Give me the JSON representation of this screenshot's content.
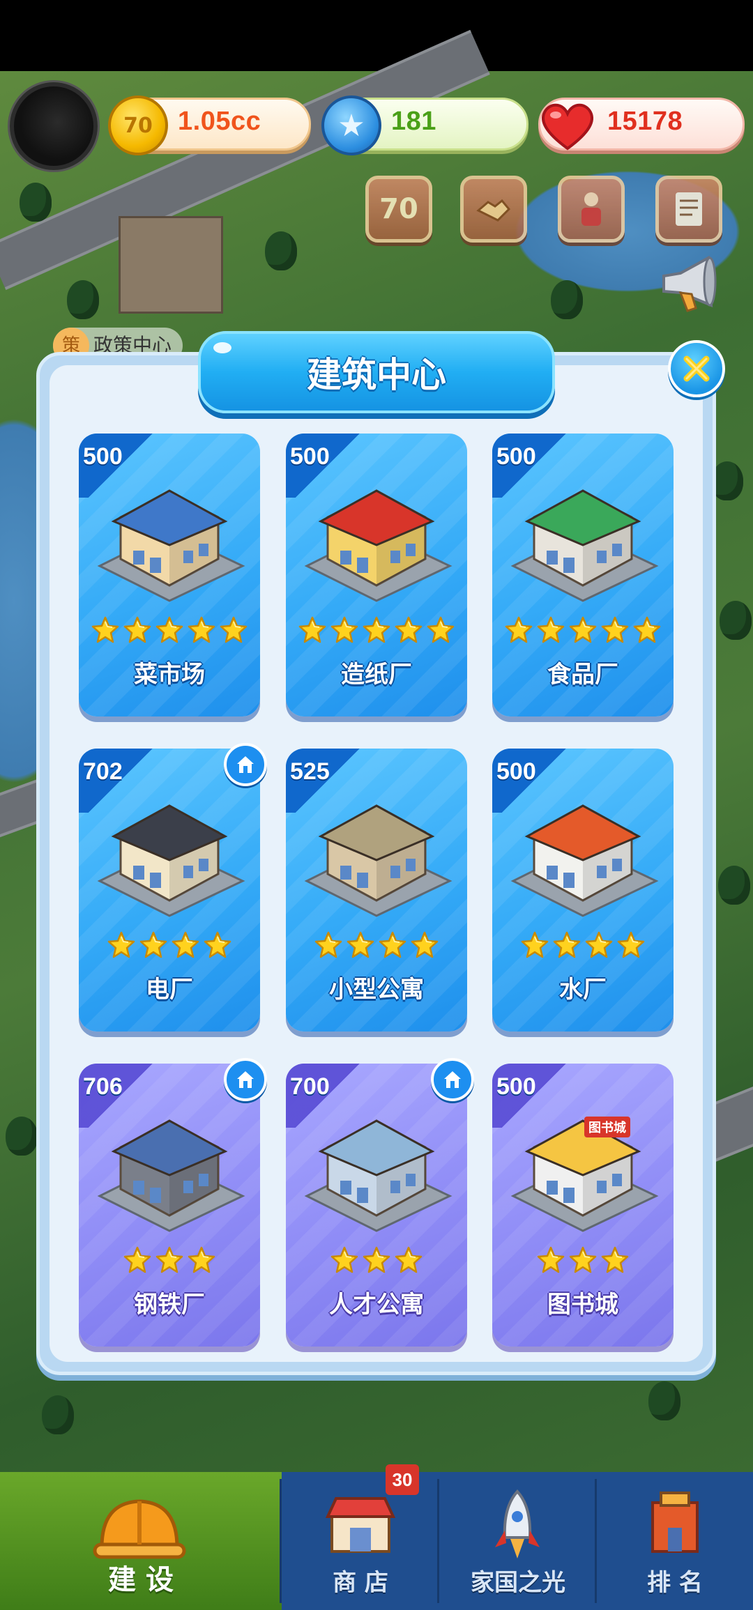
{
  "resources": {
    "coins": {
      "value": "1.05cc",
      "icon": "coin-icon",
      "coin_mark": "70"
    },
    "stars": {
      "value": "181",
      "icon": "star-coin-icon"
    },
    "hearts": {
      "value": "15178",
      "icon": "heart-icon"
    }
  },
  "hud_buttons": [
    {
      "icon": "anniversary-70-icon",
      "label": "70"
    },
    {
      "icon": "handshake-icon",
      "label": ""
    },
    {
      "icon": "hero-icon",
      "label": ""
    },
    {
      "icon": "task-list-icon",
      "label": ""
    }
  ],
  "map": {
    "policy_badge": "策",
    "policy_label": "政策中心"
  },
  "dialog": {
    "title": "建筑中心",
    "buildings": [
      {
        "name": "菜市场",
        "level": "500",
        "stars": 5,
        "theme": "blue",
        "has_home_badge": false,
        "icon": "vegetable-market-icon"
      },
      {
        "name": "造纸厂",
        "level": "500",
        "stars": 5,
        "theme": "blue",
        "has_home_badge": false,
        "icon": "paper-mill-icon"
      },
      {
        "name": "食品厂",
        "level": "500",
        "stars": 5,
        "theme": "blue",
        "has_home_badge": false,
        "icon": "food-factory-icon"
      },
      {
        "name": "电厂",
        "level": "702",
        "stars": 4,
        "theme": "blue",
        "has_home_badge": true,
        "icon": "power-plant-icon"
      },
      {
        "name": "小型公寓",
        "level": "525",
        "stars": 4,
        "theme": "blue",
        "has_home_badge": false,
        "icon": "small-apartment-icon"
      },
      {
        "name": "水厂",
        "level": "500",
        "stars": 4,
        "theme": "blue",
        "has_home_badge": false,
        "icon": "water-plant-icon"
      },
      {
        "name": "钢铁厂",
        "level": "706",
        "stars": 3,
        "theme": "purple",
        "has_home_badge": true,
        "icon": "steel-mill-icon"
      },
      {
        "name": "人才公寓",
        "level": "700",
        "stars": 3,
        "theme": "purple",
        "has_home_badge": true,
        "icon": "talent-apartment-icon"
      },
      {
        "name": "图书城",
        "level": "500",
        "stars": 3,
        "theme": "purple",
        "has_home_badge": false,
        "icon": "book-city-icon",
        "sign": "图书城"
      }
    ]
  },
  "bottom_nav": {
    "items": [
      {
        "label": "建 设",
        "icon": "hard-hat-icon",
        "active": true
      },
      {
        "label": "商 店",
        "icon": "shop-icon",
        "active": false,
        "badge": "30"
      },
      {
        "label": "家国之光",
        "icon": "rocket-icon",
        "active": false
      },
      {
        "label": "排 名",
        "icon": "ranking-building-icon",
        "active": false
      }
    ]
  },
  "colors": {
    "card_blue": "#34aaf7",
    "card_purple": "#8f8cf6",
    "title_banner": "#21aef3",
    "nav_bar": "#1f4e8f",
    "nav_active": "#5a9a22",
    "star": "#ffd21e"
  }
}
